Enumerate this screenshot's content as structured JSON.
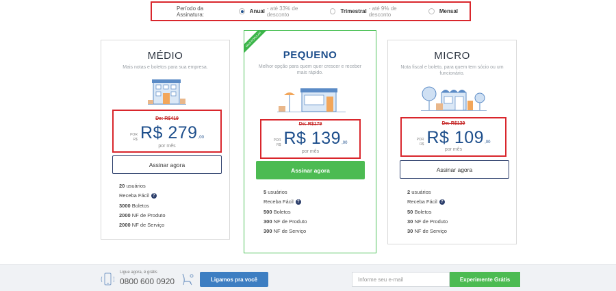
{
  "period": {
    "label": "Período da Assinatura:",
    "options": [
      {
        "name": "Anual",
        "note": "- até 33% de desconto",
        "selected": true
      },
      {
        "name": "Trimestral",
        "note": "- até 9% de desconto",
        "selected": false
      },
      {
        "name": "Mensal",
        "note": "",
        "selected": false
      }
    ]
  },
  "plans": [
    {
      "title": "MÉDIO",
      "desc": "Mais notas e boletos para sua empresa.",
      "old_price": "De: R$419",
      "por": "POR",
      "rs_small": "R$",
      "price": "R$ 279",
      "cents": ",00",
      "per": "por mês",
      "button": "Assinar agora",
      "features": [
        {
          "qty": "20",
          "label": "usuários"
        },
        {
          "qty": "",
          "label": "Receba Fácil"
        },
        {
          "qty": "3000",
          "label": "Boletos"
        },
        {
          "qty": "2000",
          "label": "NF de Produto"
        },
        {
          "qty": "2000",
          "label": "NF de Serviço"
        }
      ]
    },
    {
      "title": "PEQUENO",
      "ribbon": "MAIS POPULAR",
      "desc": "Melhor opção para quem quer crescer e receber mais rápido.",
      "old_price": "De: R$179",
      "por": "POR",
      "rs_small": "R$",
      "price": "R$ 139",
      "cents": ",00",
      "per": "por mês",
      "button": "Assinar agora",
      "features": [
        {
          "qty": "5",
          "label": "usuários"
        },
        {
          "qty": "",
          "label": "Receba Fácil"
        },
        {
          "qty": "500",
          "label": "Boletos"
        },
        {
          "qty": "300",
          "label": "NF de Produto"
        },
        {
          "qty": "300",
          "label": "NF de Serviço"
        }
      ]
    },
    {
      "title": "MICRO",
      "desc": "Nota fiscal e boleto, para quem tem sócio ou um funcionário.",
      "old_price": "De: R$139",
      "por": "POR",
      "rs_small": "R$",
      "price": "R$ 109",
      "cents": ",00",
      "per": "por mês",
      "button": "Assinar agora",
      "features": [
        {
          "qty": "2",
          "label": "usuários"
        },
        {
          "qty": "",
          "label": "Receba Fácil"
        },
        {
          "qty": "50",
          "label": "Boletos"
        },
        {
          "qty": "30",
          "label": "NF de Produto"
        },
        {
          "qty": "30",
          "label": "NF de Serviço"
        }
      ]
    }
  ],
  "footer": {
    "ligue": "Ligue agora, é grátis",
    "phone": "0800 600 0920",
    "call_button": "Ligamos pra você",
    "email_placeholder": "Informe seu e-mail",
    "trial_button": "Experimente Grátis"
  },
  "colors": {
    "accent_blue": "#1e4f8c",
    "green": "#4cbb52",
    "highlight_red": "#d9262c"
  }
}
